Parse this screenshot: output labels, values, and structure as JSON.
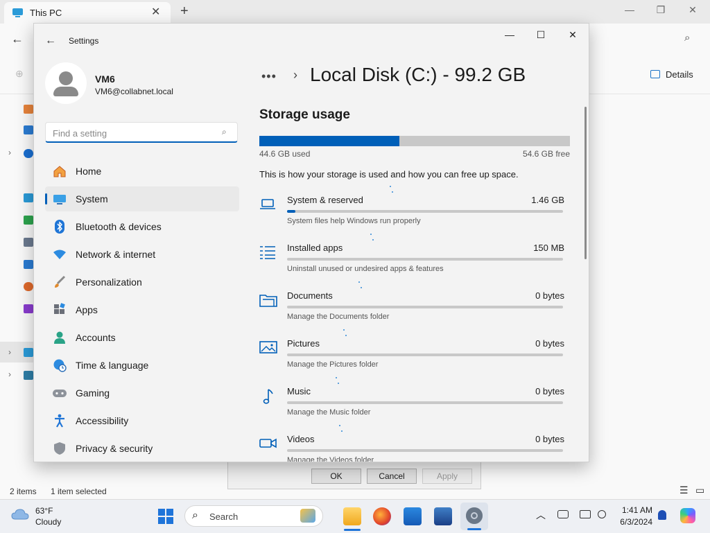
{
  "explorer": {
    "tab_title": "This PC",
    "new_tab": "+",
    "details_label": "Details",
    "status_items": "2 items",
    "status_selected": "1 item selected"
  },
  "dialog": {
    "ok": "OK",
    "cancel": "Cancel",
    "apply": "Apply"
  },
  "settings": {
    "window_title": "Settings",
    "user": {
      "name": "VM6",
      "email": "VM6@collabnet.local"
    },
    "search_placeholder": "Find a setting",
    "nav": [
      {
        "label": "Home",
        "icon": "home-icon"
      },
      {
        "label": "System",
        "icon": "system-icon",
        "selected": true
      },
      {
        "label": "Bluetooth & devices",
        "icon": "bluetooth-icon"
      },
      {
        "label": "Network & internet",
        "icon": "wifi-icon"
      },
      {
        "label": "Personalization",
        "icon": "brush-icon"
      },
      {
        "label": "Apps",
        "icon": "apps-icon"
      },
      {
        "label": "Accounts",
        "icon": "accounts-icon"
      },
      {
        "label": "Time & language",
        "icon": "clock-globe-icon"
      },
      {
        "label": "Gaming",
        "icon": "gamepad-icon"
      },
      {
        "label": "Accessibility",
        "icon": "accessibility-icon"
      },
      {
        "label": "Privacy & security",
        "icon": "shield-icon"
      }
    ],
    "breadcrumb_more": "•••",
    "breadcrumb_sep": "›",
    "page_title": "Local Disk (C:) - 99.2 GB",
    "storage_heading": "Storage usage",
    "used_label": "44.6 GB used",
    "free_label": "54.6 GB free",
    "used_fraction": 0.45,
    "description": "This is how your storage is used and how you can free up space.",
    "categories": [
      {
        "name": "System & reserved",
        "size": "1.46 GB",
        "desc": "System files help Windows run properly",
        "fill": 0.03,
        "icon": "laptop-icon"
      },
      {
        "name": "Installed apps",
        "size": "150 MB",
        "desc": "Uninstall unused or undesired apps & features",
        "fill": 0.0,
        "icon": "list-icon"
      },
      {
        "name": "Documents",
        "size": "0 bytes",
        "desc": "Manage the Documents folder",
        "fill": 0.0,
        "icon": "folder-icon"
      },
      {
        "name": "Pictures",
        "size": "0 bytes",
        "desc": "Manage the Pictures folder",
        "fill": 0.0,
        "icon": "picture-icon"
      },
      {
        "name": "Music",
        "size": "0 bytes",
        "desc": "Manage the Music folder",
        "fill": 0.0,
        "icon": "music-note-icon"
      },
      {
        "name": "Videos",
        "size": "0 bytes",
        "desc": "Manage the Videos folder",
        "fill": 0.0,
        "icon": "video-camera-icon"
      }
    ]
  },
  "taskbar": {
    "weather_temp": "63°F",
    "weather_cond": "Cloudy",
    "search_label": "Search",
    "time": "1:41 AM",
    "date": "6/3/2024"
  },
  "colors": {
    "accent": "#005fb8",
    "bar_track": "#c8c8c8",
    "taskbar": "#eef0f4"
  }
}
